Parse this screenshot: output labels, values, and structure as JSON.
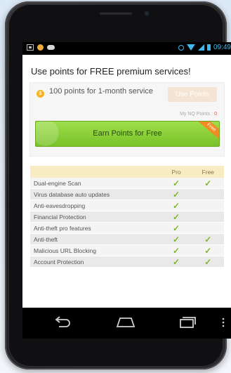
{
  "status_bar": {
    "time": "09:49",
    "icons": [
      "screenshot-icon",
      "notification-dot-icon",
      "cloud-icon",
      "alarm-icon",
      "wifi-icon",
      "signal-icon",
      "battery-icon"
    ]
  },
  "page": {
    "heading": "Use points for FREE premium services!"
  },
  "offer": {
    "text": "100 points for 1-month service",
    "use_button": "Use Points",
    "my_points_label": "My NQ Points :",
    "my_points_value": "0"
  },
  "earn": {
    "button_label": "Earn Points for Free",
    "ribbon": "Free"
  },
  "features": {
    "columns": [
      "Pro",
      "Free"
    ],
    "rows": [
      {
        "name": "Dual-engine Scan",
        "pro": true,
        "free": true
      },
      {
        "name": "Virus database auto updates",
        "pro": true,
        "free": false
      },
      {
        "name": "Anti-eavesdropping",
        "pro": true,
        "free": false
      },
      {
        "name": "Financial Protection",
        "pro": true,
        "free": false
      },
      {
        "name": "Anti-theft pro features",
        "pro": true,
        "free": false
      },
      {
        "name": "Anti-theft",
        "pro": true,
        "free": true
      },
      {
        "name": "Malicious URL Blocking",
        "pro": true,
        "free": true
      },
      {
        "name": "Account Protection",
        "pro": true,
        "free": true
      }
    ],
    "check_glyph": "✓"
  },
  "colors": {
    "accent_green": "#7bb82b",
    "status_blue": "#3fb6ee",
    "ribbon_orange": "#f28b23"
  }
}
